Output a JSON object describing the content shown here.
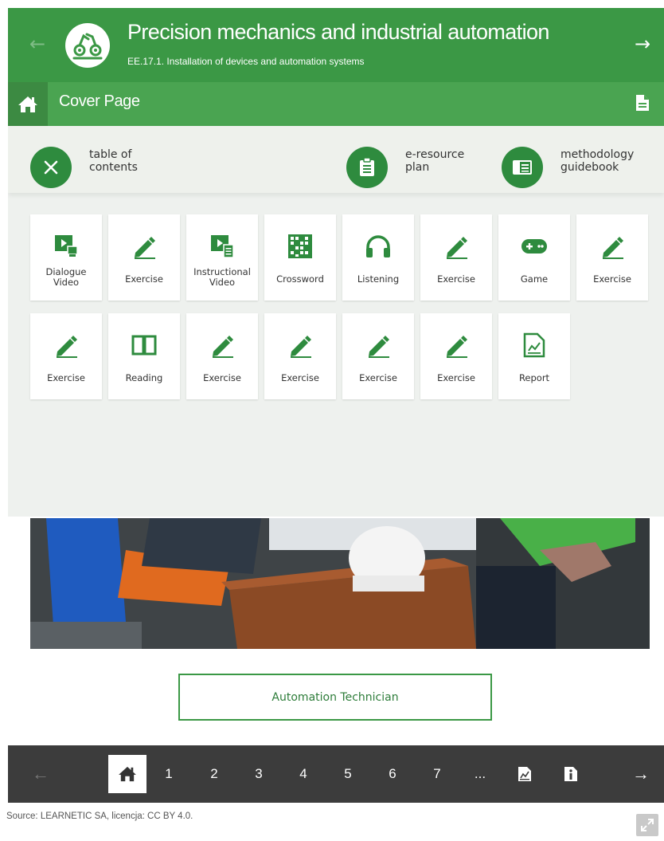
{
  "header": {
    "title": "Precision mechanics and industrial automation",
    "subtitle": "EE.17.1. Installation of devices and automation systems",
    "prev_icon": "arrow-left-icon",
    "next_icon": "arrow-right-icon"
  },
  "cover": {
    "label": "Cover Page"
  },
  "toc_bar": {
    "close_label": "table of contents",
    "plan_label": "e-resource plan",
    "guide_label": "methodology guidebook"
  },
  "tiles": [
    {
      "label": "Dialogue Video",
      "icon": "video-icon"
    },
    {
      "label": "Exercise",
      "icon": "pencil-icon"
    },
    {
      "label": "Instructional Video",
      "icon": "video-doc-icon"
    },
    {
      "label": "Crossword",
      "icon": "crossword-icon"
    },
    {
      "label": "Listening",
      "icon": "headphones-icon"
    },
    {
      "label": "Exercise",
      "icon": "pencil-icon"
    },
    {
      "label": "Game",
      "icon": "gamepad-icon"
    },
    {
      "label": "Exercise",
      "icon": "pencil-icon"
    },
    {
      "label": "Exercise",
      "icon": "pencil-icon"
    },
    {
      "label": "Reading",
      "icon": "book-icon"
    },
    {
      "label": "Exercise",
      "icon": "pencil-icon"
    },
    {
      "label": "Exercise",
      "icon": "pencil-icon"
    },
    {
      "label": "Exercise",
      "icon": "pencil-icon"
    },
    {
      "label": "Exercise",
      "icon": "pencil-icon"
    },
    {
      "label": "Report",
      "icon": "report-icon"
    }
  ],
  "cta_label": "Automation Technician",
  "pager": {
    "pages": [
      "1",
      "2",
      "3",
      "4",
      "5",
      "6",
      "7",
      "..."
    ]
  },
  "source": "Source: LEARNETIC SA, licencja: CC BY 4.0.",
  "colors": {
    "brand_green": "#3b9845",
    "dark_green": "#2e8b3e",
    "panel_bg": "#eef1ee",
    "pager_bg": "#3c3c3c"
  }
}
